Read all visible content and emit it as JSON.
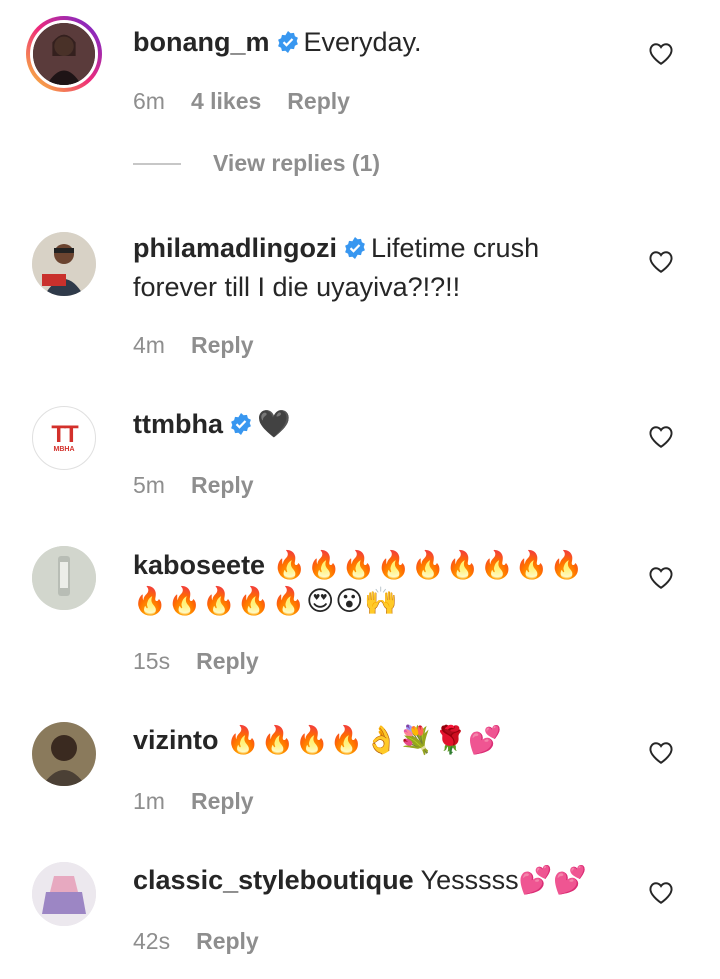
{
  "comments": [
    {
      "username": "bonang_m",
      "verified": true,
      "text": "Everyday.",
      "emojis": "",
      "time": "6m",
      "likes": "4 likes",
      "reply": "Reply",
      "view_replies": "View replies (1)"
    },
    {
      "username": "philamadlingozi",
      "verified": true,
      "text": "Lifetime crush forever till I die uyayiva?!?!!",
      "emojis": "",
      "time": "4m",
      "reply": "Reply"
    },
    {
      "username": "ttmbha",
      "verified": true,
      "text": "",
      "emojis": "🖤",
      "time": "5m",
      "reply": "Reply",
      "avatar_text_top": "TT",
      "avatar_text_bottom": "MBHA"
    },
    {
      "username": "kaboseete",
      "verified": false,
      "text": "",
      "emojis": "🔥🔥🔥🔥🔥🔥🔥🔥🔥🔥🔥🔥🔥🔥😍😮🙌",
      "time": "15s",
      "reply": "Reply"
    },
    {
      "username": "vizinto",
      "verified": false,
      "text": "",
      "emojis": "🔥🔥🔥🔥👌💐🌹💕",
      "time": "1m",
      "reply": "Reply"
    },
    {
      "username": "classic_styleboutique",
      "verified": false,
      "text": "Yesssss",
      "emojis": "💕💕",
      "time": "42s",
      "reply": "Reply"
    }
  ],
  "colors": {
    "verified_blue": "#3897f0",
    "muted_text": "#8e8e8e",
    "primary_text": "#262626"
  },
  "icons": {
    "like": "heart-outline-icon",
    "verified": "verified-badge-icon"
  }
}
